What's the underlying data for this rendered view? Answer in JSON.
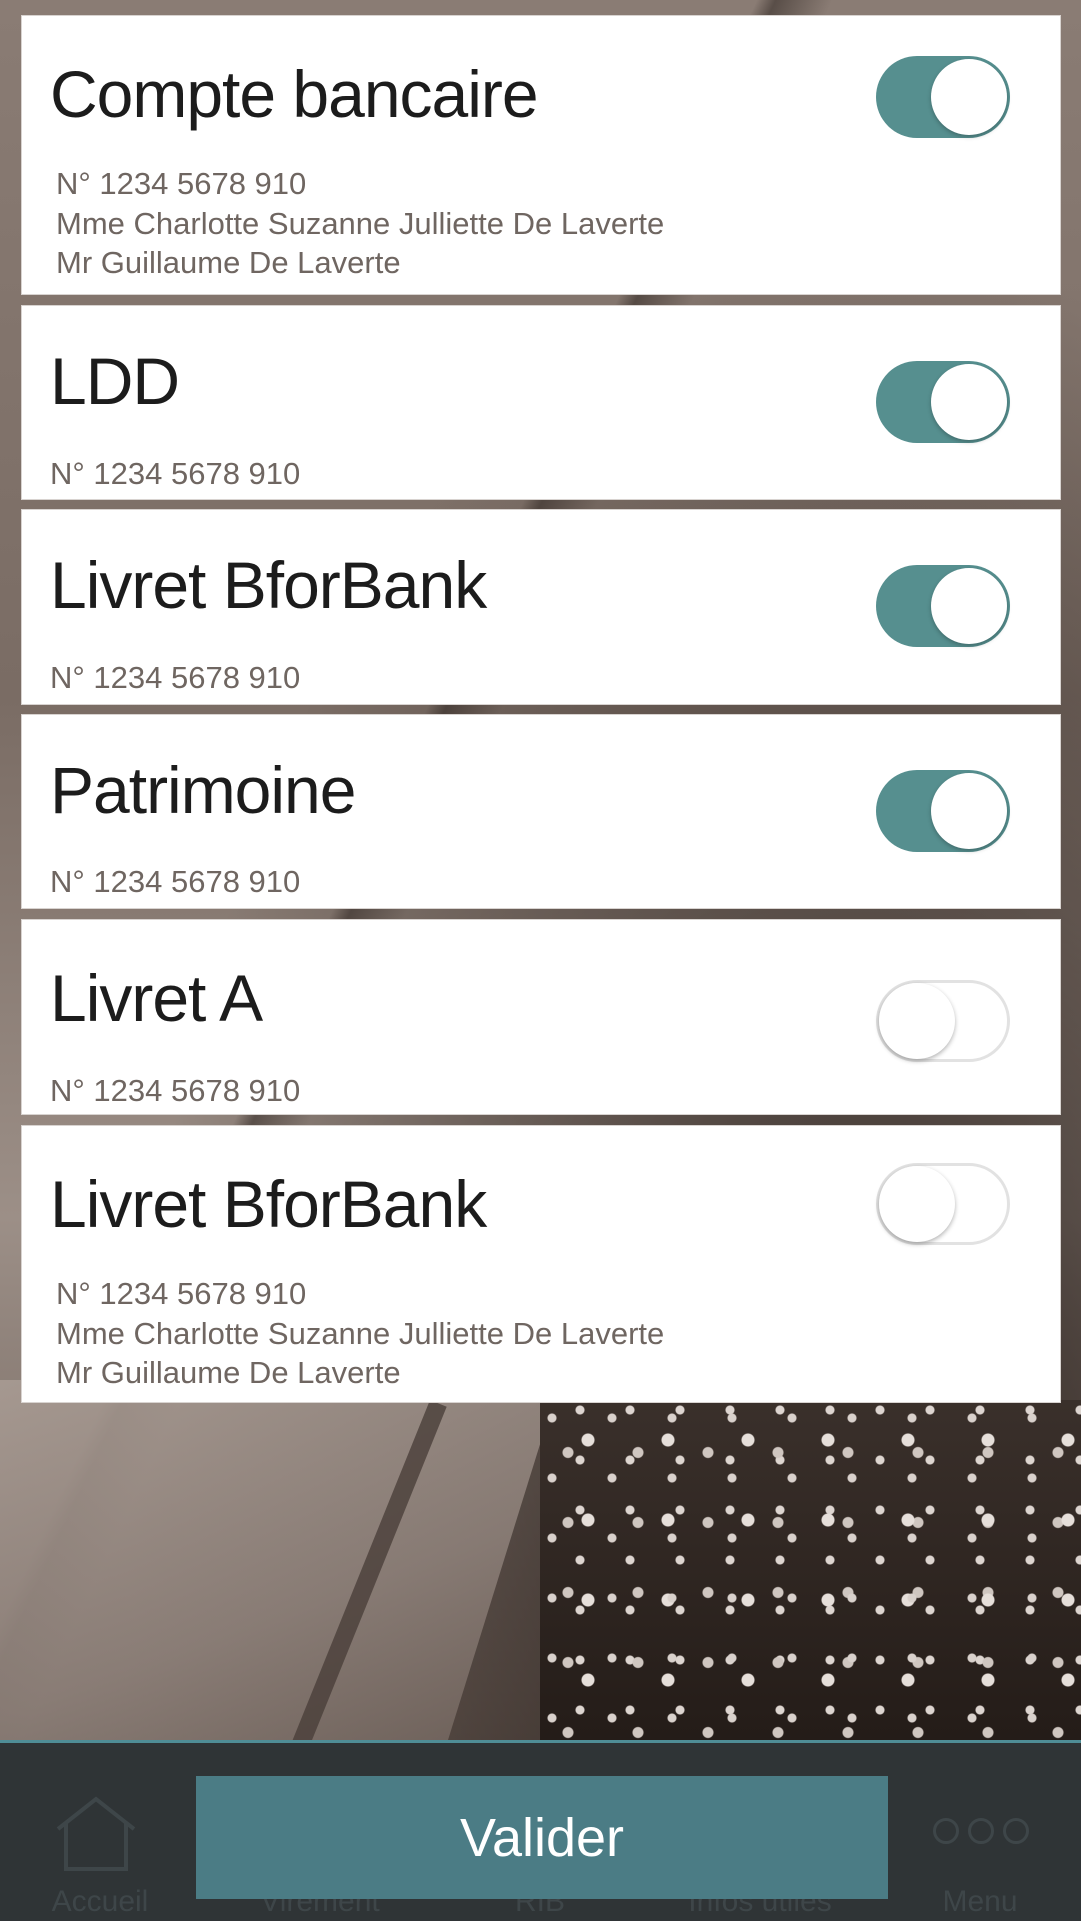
{
  "accounts": [
    {
      "title": "Compte bancaire",
      "number": "N° 1234 5678 910",
      "holder1": "Mme Charlotte Suzanne Julliette De Laverte",
      "holder2": "Mr Guillaume De Laverte",
      "enabled": true
    },
    {
      "title": "LDD",
      "number": "N° 1234 5678 910",
      "enabled": true
    },
    {
      "title": "Livret BforBank",
      "number": "N° 1234 5678 910",
      "enabled": true
    },
    {
      "title": "Patrimoine",
      "number": "N° 1234 5678 910",
      "enabled": true
    },
    {
      "title": "Livret A",
      "number": "N° 1234 5678 910",
      "enabled": false
    },
    {
      "title": "Livret BforBank",
      "number": "N° 1234 5678 910",
      "holder1": "Mme Charlotte Suzanne Julliette De Laverte",
      "holder2": "Mr Guillaume De Laverte",
      "enabled": false
    }
  ],
  "tabbar": {
    "home_label": "Accueil",
    "transfer_label": "Virement",
    "rib_label": "RIB",
    "info_label": "Infos utiles",
    "menu_label": "Menu"
  },
  "valider_label": "Valider",
  "colors": {
    "toggle_on": "#568f8f",
    "button": "#4b7c85",
    "tabbar": "#2f3436",
    "tabbar_accent": "#4f8d96"
  },
  "icons": {
    "home": "home-icon",
    "menu": "menu-dots-icon"
  }
}
